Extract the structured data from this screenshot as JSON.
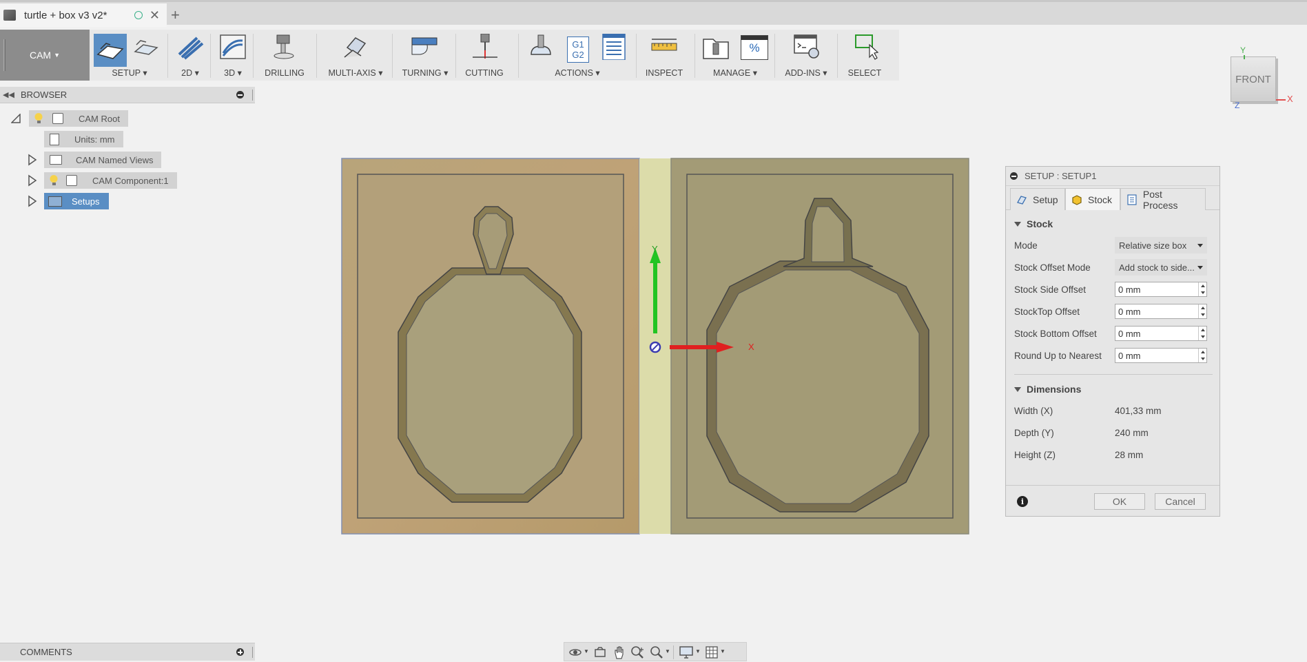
{
  "document": {
    "title": "turtle + box v3 v2*"
  },
  "toolbar": {
    "workspace": "CAM",
    "groups": [
      {
        "id": "setup",
        "label": "SETUP"
      },
      {
        "id": "2d",
        "label": "2D"
      },
      {
        "id": "3d",
        "label": "3D"
      },
      {
        "id": "drilling",
        "label": "DRILLING"
      },
      {
        "id": "multiaxis",
        "label": "MULTI-AXIS"
      },
      {
        "id": "turning",
        "label": "TURNING"
      },
      {
        "id": "cutting",
        "label": "CUTTING"
      },
      {
        "id": "actions",
        "label": "ACTIONS"
      },
      {
        "id": "inspect",
        "label": "INSPECT"
      },
      {
        "id": "manage",
        "label": "MANAGE"
      },
      {
        "id": "addins",
        "label": "ADD-INS"
      },
      {
        "id": "select",
        "label": "SELECT"
      }
    ],
    "actions_icon_text": {
      "g1": "G1",
      "g2": "G2"
    },
    "manage_icon_text": "%"
  },
  "browser": {
    "title": "BROWSER",
    "items": [
      {
        "label": "CAM Root"
      },
      {
        "label": "Units: mm"
      },
      {
        "label": "CAM Named Views"
      },
      {
        "label": "CAM Component:1"
      },
      {
        "label": "Setups"
      }
    ]
  },
  "comments": {
    "title": "COMMENTS"
  },
  "viewport": {
    "axis_x": "X",
    "axis_y": "Y",
    "viewcube": {
      "face": "FRONT",
      "x": "X",
      "y": "Y",
      "z": "Z"
    }
  },
  "dialog": {
    "title": "SETUP : SETUP1",
    "tabs": [
      {
        "label": "Setup",
        "active": false
      },
      {
        "label": "Stock",
        "active": true
      },
      {
        "label": "Post Process",
        "active": false
      }
    ],
    "stock_section": "Stock",
    "fields": {
      "mode": {
        "label": "Mode",
        "value": "Relative size box"
      },
      "offset_mode": {
        "label": "Stock Offset Mode",
        "value": "Add stock to side..."
      },
      "side_offset": {
        "label": "Stock Side Offset",
        "value": "0 mm"
      },
      "top_offset": {
        "label": "StockTop Offset",
        "value": "0 mm"
      },
      "bottom_offset": {
        "label": "Stock Bottom Offset",
        "value": "0 mm"
      },
      "round_up": {
        "label": "Round Up to Nearest",
        "value": "0 mm"
      }
    },
    "dimensions_section": "Dimensions",
    "dimensions": {
      "width": {
        "label": "Width (X)",
        "value": "401,33 mm"
      },
      "depth": {
        "label": "Depth (Y)",
        "value": "240 mm"
      },
      "height": {
        "label": "Height (Z)",
        "value": "28 mm"
      }
    },
    "ok": "OK",
    "cancel": "Cancel"
  },
  "colors": {
    "accent": "#5a8ec4",
    "axis_x": "#e02020",
    "axis_y": "#22c422"
  }
}
